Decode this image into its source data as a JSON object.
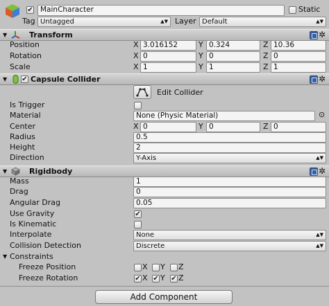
{
  "top": {
    "object_name": "MainCharacter",
    "active_checked": true,
    "static_label": "Static",
    "static_checked": false,
    "tag_label": "Tag",
    "tag_value": "Untagged",
    "layer_label": "Layer",
    "layer_value": "Default"
  },
  "transform": {
    "title": "Transform",
    "position_label": "Position",
    "rotation_label": "Rotation",
    "scale_label": "Scale",
    "position": {
      "x": "3.016152",
      "y": "0.324",
      "z": "10.36"
    },
    "rotation": {
      "x": "0",
      "y": "0",
      "z": "0"
    },
    "scale": {
      "x": "1",
      "y": "1",
      "z": "1"
    }
  },
  "axis": {
    "x": "X",
    "y": "Y",
    "z": "Z"
  },
  "collider": {
    "title": "Capsule Collider",
    "enabled": true,
    "edit_button": "Edit Collider",
    "is_trigger_label": "Is Trigger",
    "is_trigger": false,
    "material_label": "Material",
    "material_value": "None (Physic Material)",
    "center_label": "Center",
    "center": {
      "x": "0",
      "y": "0",
      "z": "0"
    },
    "radius_label": "Radius",
    "radius_value": "0.5",
    "height_label": "Height",
    "height_value": "2",
    "direction_label": "Direction",
    "direction_value": "Y-Axis"
  },
  "rigidbody": {
    "title": "Rigidbody",
    "mass_label": "Mass",
    "mass_value": "1",
    "drag_label": "Drag",
    "drag_value": "0",
    "angular_drag_label": "Angular Drag",
    "angular_drag_value": "0.05",
    "use_gravity_label": "Use Gravity",
    "use_gravity": true,
    "is_kinematic_label": "Is Kinematic",
    "is_kinematic": false,
    "interpolate_label": "Interpolate",
    "interpolate_value": "None",
    "collision_detection_label": "Collision Detection",
    "collision_detection_value": "Discrete",
    "constraints_label": "Constraints",
    "freeze_position_label": "Freeze Position",
    "freeze_rotation_label": "Freeze Rotation",
    "freeze_position": {
      "x": false,
      "y": false,
      "z": false
    },
    "freeze_rotation": {
      "x": true,
      "y": true,
      "z": true
    }
  },
  "add_component_label": "Add Component",
  "icons": {
    "object": "cube-icon",
    "transform": "transform-axes-icon",
    "collider": "capsule-icon",
    "rigidbody": "rigidbody-icon",
    "help": "help-book-icon",
    "gear": "gear-icon",
    "fold": "fold-triangle-icon",
    "edit_collider": "edit-collider-icon",
    "object_picker": "object-picker-icon"
  },
  "colors": {
    "background": "#c2c2c2",
    "header": "#c4c4c4",
    "field": "#f4f4f4",
    "checkmark": "#222222"
  }
}
